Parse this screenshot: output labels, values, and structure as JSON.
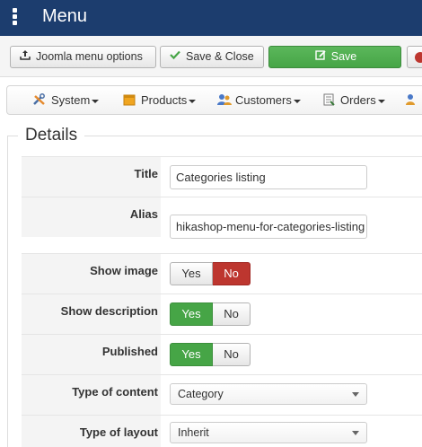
{
  "header": {
    "title": "Menu"
  },
  "toolbar": {
    "options_label": "Joomla menu options",
    "save_close_label": "Save & Close",
    "save_label": "Save"
  },
  "nav": {
    "items": [
      {
        "label": "System",
        "icon": "tools-icon"
      },
      {
        "label": "Products",
        "icon": "box-icon"
      },
      {
        "label": "Customers",
        "icon": "users-icon"
      },
      {
        "label": "Orders",
        "icon": "document-icon"
      }
    ]
  },
  "details": {
    "legend": "Details",
    "fields": {
      "title": {
        "label": "Title",
        "value": "Categories listing"
      },
      "alias": {
        "label": "Alias",
        "value": "hikashop-menu-for-categories-listing"
      },
      "show_image": {
        "label": "Show image",
        "yes": "Yes",
        "no": "No",
        "selected": "No"
      },
      "show_description": {
        "label": "Show description",
        "yes": "Yes",
        "no": "No",
        "selected": "Yes"
      },
      "published": {
        "label": "Published",
        "yes": "Yes",
        "no": "No",
        "selected": "Yes"
      },
      "type_of_content": {
        "label": "Type of content",
        "value": "Category"
      },
      "type_of_layout": {
        "label": "Type of layout",
        "value": "Inherit"
      }
    }
  },
  "colors": {
    "header_bg": "#1c3d6e",
    "save_green": "#46a546",
    "toggle_red": "#bd362f",
    "toggle_green": "#46a546"
  }
}
